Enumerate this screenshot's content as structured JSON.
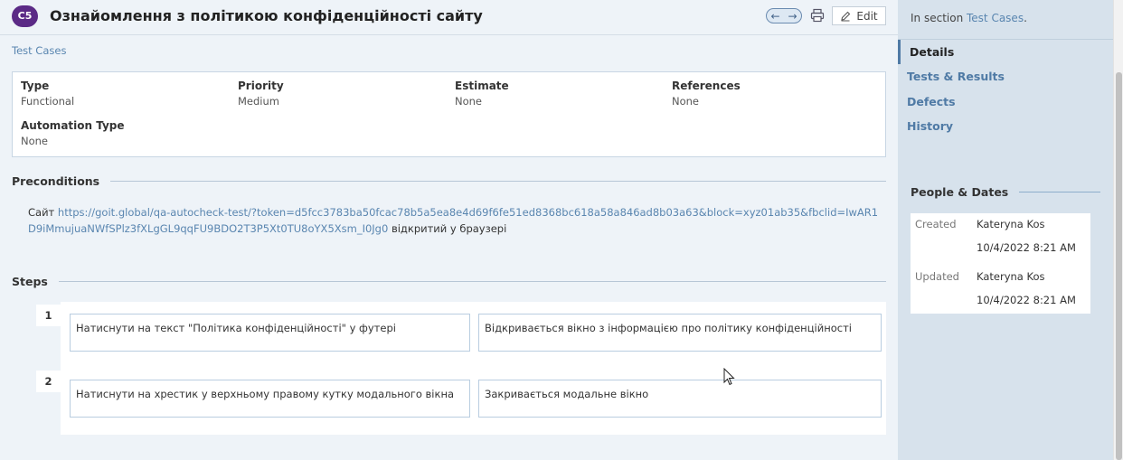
{
  "header": {
    "badge": "C5",
    "title": "Ознайомлення з політикою конфіденційності сайту",
    "edit_label": "Edit"
  },
  "breadcrumb": "Test Cases",
  "fields": {
    "type": {
      "label": "Type",
      "value": "Functional"
    },
    "priority": {
      "label": "Priority",
      "value": "Medium"
    },
    "estimate": {
      "label": "Estimate",
      "value": "None"
    },
    "references": {
      "label": "References",
      "value": "None"
    },
    "automation_type": {
      "label": "Automation Type",
      "value": "None"
    }
  },
  "preconditions": {
    "heading": "Preconditions",
    "prefix": "Сайт ",
    "link": "https://goit.global/qa-autocheck-test/?token=d5fcc3783ba50fcac78b5a5ea8e4d69f6fe51ed8368bc618a58a846ad8b03a63&block=xyz01ab35&fbclid=IwAR1D9iMmujuaNWfSPlz3fXLgGL9qqFU9BDO2T3P5Xt0TU8oYX5Xsm_I0Jg0",
    "suffix": " відкритий у браузері"
  },
  "steps": {
    "heading": "Steps",
    "items": [
      {
        "num": "1",
        "action": "Натиснути на текст \"Політика конфіденційності\" у футері",
        "expected": "Відкривається вікно з інформацією про політику конфіденційності"
      },
      {
        "num": "2",
        "action": "Натиснути на хрестик у верхньому правому кутку модального вікна",
        "expected": "Закривається модальне вікно"
      }
    ]
  },
  "sidebar": {
    "in_section_prefix": "In section ",
    "in_section_link": "Test Cases",
    "in_section_suffix": ".",
    "nav": [
      "Details",
      "Tests & Results",
      "Defects",
      "History"
    ],
    "people_heading": "People & Dates",
    "created_label": "Created",
    "created_by": "Kateryna Kos",
    "created_date": "10/4/2022 8:21 AM",
    "updated_label": "Updated",
    "updated_by": "Kateryna Kos",
    "updated_date": "10/4/2022 8:21 AM"
  },
  "colors": {
    "badge": "#5b2a86",
    "link": "#5a86b0",
    "sidebar_bg": "#d7e2ec",
    "page_bg": "#eef3f8"
  }
}
